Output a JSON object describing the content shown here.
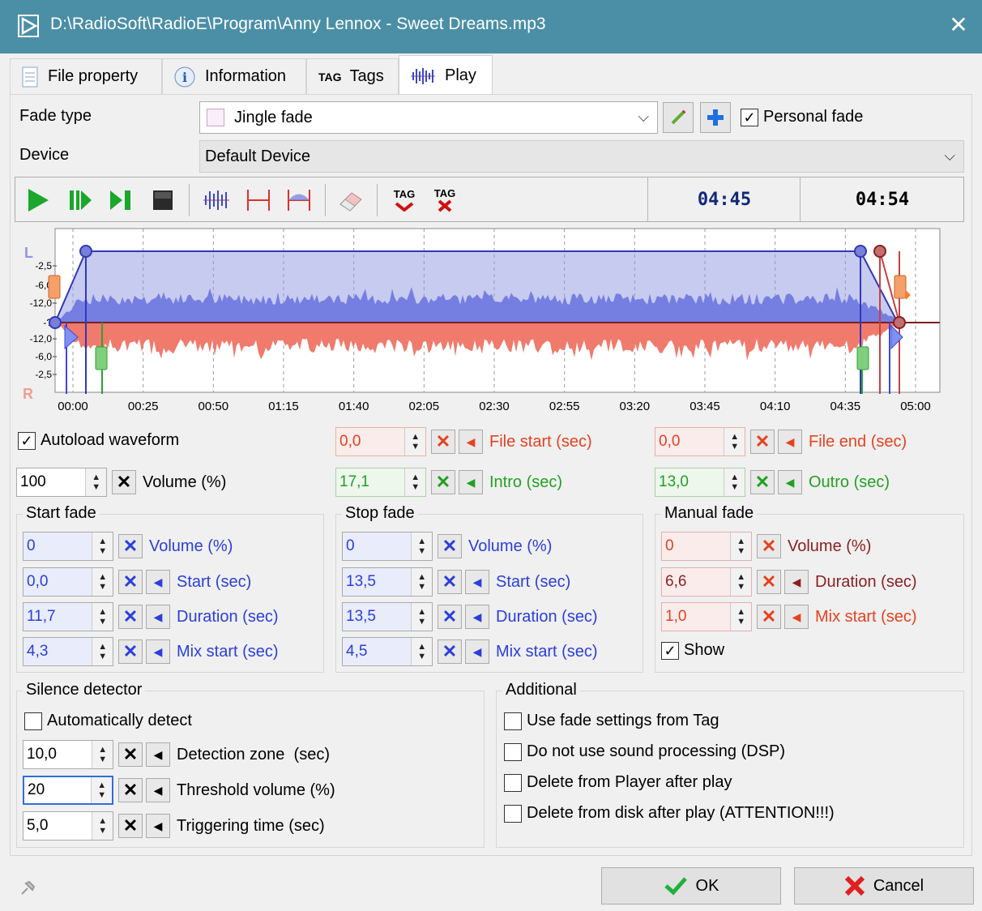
{
  "window": {
    "title": "D:\\RadioSoft\\RadioE\\Program\\Anny Lennox - Sweet Dreams.mp3",
    "close_glyph": "✕"
  },
  "tabs": [
    {
      "label": "File property",
      "icon": "document-icon"
    },
    {
      "label": "Information",
      "icon": "info-icon"
    },
    {
      "label": "Tags",
      "icon_text": "TAG"
    },
    {
      "label": "Play",
      "icon": "waveform-icon",
      "active": true
    }
  ],
  "fade_type": {
    "label": "Fade type",
    "value": "Jingle fade",
    "personal_fade_label": "Personal fade",
    "personal_fade_checked": true
  },
  "device": {
    "label": "Device",
    "value": "Default Device"
  },
  "toolbar": {
    "time_position": "04:45",
    "time_total": "04:54",
    "tag_text": "TAG"
  },
  "waveform": {
    "channel_top": "L",
    "channel_bottom": "R",
    "db_labels": [
      "-2,5",
      "-6,0",
      "-12,0",
      "-?",
      "-12,0",
      "-6,0",
      "-2,5"
    ],
    "time_ticks": [
      "00:00",
      "00:25",
      "00:50",
      "01:15",
      "01:40",
      "02:05",
      "02:30",
      "02:55",
      "03:20",
      "03:45",
      "04:10",
      "04:35",
      "05:00"
    ],
    "colors": {
      "left": "#5a66e0",
      "right": "#f07a6c",
      "fade_fill": "#b8bde8"
    }
  },
  "autoload": {
    "label": "Autoload waveform",
    "checked": true
  },
  "volume": {
    "value": "100",
    "label": "Volume (%)"
  },
  "file_start": {
    "value": "0,0",
    "label": "File start (sec)"
  },
  "file_end": {
    "value": "0,0",
    "label": "File end (sec)"
  },
  "intro": {
    "value": "17,1",
    "label": "Intro (sec)"
  },
  "outro": {
    "value": "13,0",
    "label": "Outro (sec)"
  },
  "start_fade": {
    "title": "Start fade",
    "rows": [
      {
        "value": "0",
        "label": "Volume (%)"
      },
      {
        "value": "0,0",
        "label": "Start (sec)"
      },
      {
        "value": "11,7",
        "label": "Duration (sec)"
      },
      {
        "value": "4,3",
        "label": "Mix start (sec)"
      }
    ]
  },
  "stop_fade": {
    "title": "Stop fade",
    "rows": [
      {
        "value": "0",
        "label": "Volume (%)"
      },
      {
        "value": "13,5",
        "label": "Start (sec)"
      },
      {
        "value": "13,5",
        "label": "Duration (sec)"
      },
      {
        "value": "4,5",
        "label": "Mix start (sec)"
      }
    ]
  },
  "manual_fade": {
    "title": "Manual fade",
    "rows": [
      {
        "value": "0",
        "label": "Volume (%)"
      },
      {
        "value": "6,6",
        "label": "Duration (sec)"
      },
      {
        "value": "1,0",
        "label": "Mix start (sec)"
      }
    ],
    "show_label": "Show",
    "show_checked": true
  },
  "silence": {
    "title": "Silence detector",
    "auto_label": "Automatically detect",
    "auto_checked": false,
    "rows": [
      {
        "value": "10,0",
        "label": "Detection zone  (sec)"
      },
      {
        "value": "20",
        "label": "Threshold volume (%)"
      },
      {
        "value": "5,0",
        "label": "Triggering time (sec)"
      }
    ]
  },
  "additional": {
    "title": "Additional",
    "items": [
      {
        "label": "Use fade settings from Tag",
        "checked": false
      },
      {
        "label": "Do not use sound processing (DSP)",
        "checked": false
      },
      {
        "label": "Delete from Player after play",
        "checked": false
      },
      {
        "label": "Delete from disk after play (ATTENTION!!!)",
        "checked": false
      }
    ]
  },
  "buttons": {
    "ok": "OK",
    "cancel": "Cancel"
  },
  "glyphs": {
    "check": "✓",
    "x": "✕",
    "up": "▲",
    "down": "▼",
    "left": "◀",
    "chevron": "⌵"
  }
}
